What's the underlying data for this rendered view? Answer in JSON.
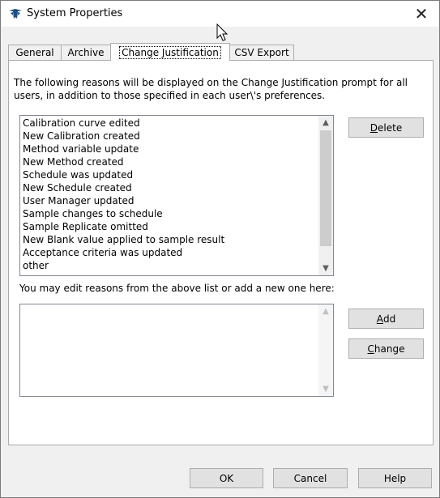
{
  "window": {
    "title": "System Properties",
    "close_glyph": "✕"
  },
  "icons": {
    "app": "teledyne-logo-icon",
    "cursor": "mouse-pointer-icon",
    "scroll_up": "▲",
    "scroll_down": "▼"
  },
  "tabs": [
    {
      "label": "General",
      "active": false
    },
    {
      "label": "Archive",
      "active": false
    },
    {
      "label": "Change Justification",
      "active": true
    },
    {
      "label": "CSV Export",
      "active": false
    }
  ],
  "intro_text": "The following reasons will be displayed on the Change Justification prompt for all users, in addition to those specified in each user\\'s preferences.",
  "reasons": [
    "Calibration curve edited",
    "New Calibration created",
    "Method variable update",
    "New Method created",
    "Schedule was updated",
    "New Schedule created",
    "User Manager updated",
    "Sample changes to schedule",
    "Sample Replicate omitted",
    "New Blank value applied to sample result",
    "Acceptance criteria was updated",
    "other"
  ],
  "buttons": {
    "delete_prefix": "",
    "delete_hotkey": "D",
    "delete_rest": "elete",
    "add_hotkey": "A",
    "add_rest": "dd",
    "change_hotkey": "C",
    "change_rest": "hange",
    "ok": "OK",
    "cancel": "Cancel",
    "help": "Help"
  },
  "edit_label": "You may edit reasons from the above list or add a new one here:",
  "edit_value": "",
  "colors": {
    "logo": "#1a4f8a",
    "panel_bg": "#ffffff",
    "window_bg": "#f0f0f0"
  }
}
